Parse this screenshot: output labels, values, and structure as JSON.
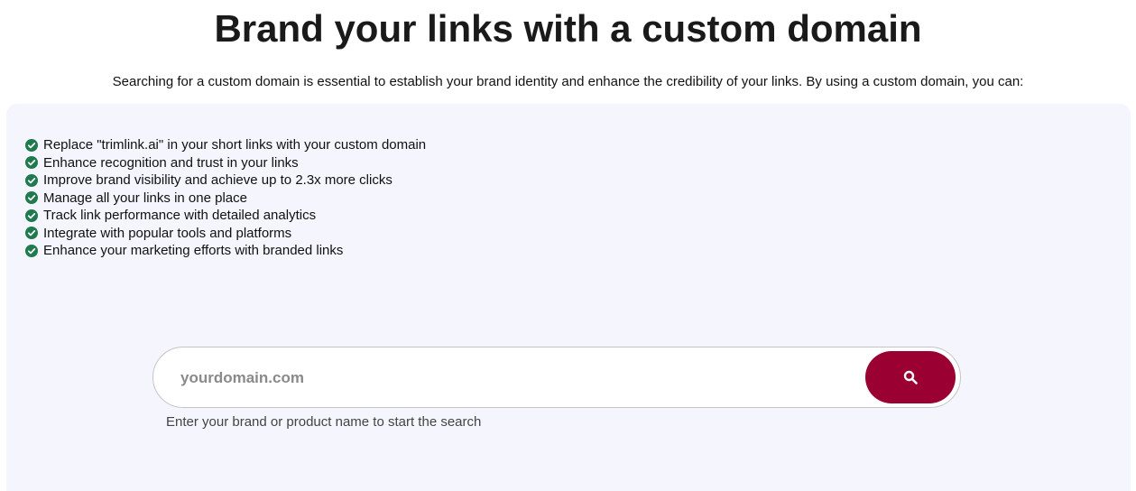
{
  "header": {
    "title": "Brand your links with a custom domain",
    "subtitle": "Searching for a custom domain is essential to establish your brand identity and enhance the credibility of your links. By using a custom domain, you can:"
  },
  "benefits": [
    {
      "icon": "check-circle-icon",
      "label": "Replace \"trimlink.ai\" in your short links with your custom domain"
    },
    {
      "icon": "check-circle-icon",
      "label": "Enhance recognition and trust in your links"
    },
    {
      "icon": "check-circle-icon",
      "label": "Improve brand visibility and achieve up to 2.3x more clicks"
    },
    {
      "icon": "check-circle-icon",
      "label": "Manage all your links in one place"
    },
    {
      "icon": "check-circle-icon",
      "label": "Track link performance with detailed analytics"
    },
    {
      "icon": "check-circle-icon",
      "label": "Integrate with popular tools and platforms"
    },
    {
      "icon": "check-circle-icon",
      "label": "Enhance your marketing efforts with branded links"
    }
  ],
  "search": {
    "placeholder": "yourdomain.com",
    "value": "",
    "button_icon": "search-icon",
    "hint": "Enter your brand or product name to start the search"
  },
  "colors": {
    "check": "#1f7a4d",
    "button": "#9b0033",
    "panel_background": "#f4f5fd"
  }
}
